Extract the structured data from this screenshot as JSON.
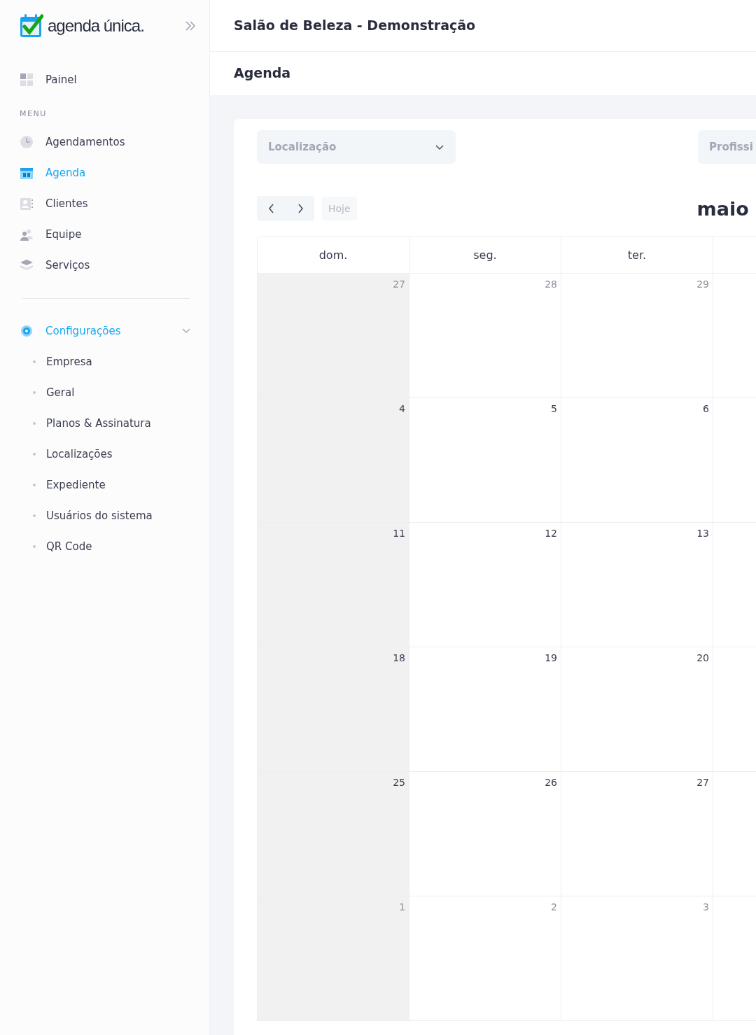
{
  "sidebar": {
    "brand": "agenda única.",
    "top_item": {
      "label": "Painel",
      "kind": "grid",
      "selected": false
    },
    "section_label": "MENU",
    "items": [
      {
        "label": "Agendamentos",
        "kind": "clock",
        "selected": false
      },
      {
        "label": "Agenda",
        "kind": "calendar",
        "selected": true
      },
      {
        "label": "Clientes",
        "kind": "contacts",
        "selected": false
      },
      {
        "label": "Equipe",
        "kind": "people",
        "selected": false
      },
      {
        "label": "Serviços",
        "kind": "layers",
        "selected": false
      }
    ],
    "settings": {
      "label": "Configurações",
      "selected": true,
      "expanded": true,
      "children": [
        {
          "label": "Empresa",
          "selected": false
        },
        {
          "label": "Geral",
          "selected": false
        },
        {
          "label": "Planos & Assinatura",
          "selected": false
        },
        {
          "label": "Localizações",
          "selected": false
        },
        {
          "label": "Expediente",
          "selected": false
        },
        {
          "label": "Usuários do sistema",
          "selected": false
        },
        {
          "label": "QR Code",
          "selected": false
        }
      ]
    }
  },
  "header": {
    "title": "Salão de Beleza - Demonstração",
    "subtitle": "Agenda"
  },
  "filters": [
    {
      "placeholder": "Localização",
      "kind": "dropdown"
    },
    {
      "placeholder": "Profissi",
      "kind": "partial"
    }
  ],
  "toolbar": {
    "today": "Hoje",
    "month_title": "maio"
  },
  "calendar": {
    "weekdays": [
      {
        "label": "dom.",
        "shaded": true
      },
      {
        "label": "seg.",
        "shaded": false
      },
      {
        "label": "ter.",
        "shaded": false
      }
    ],
    "weeks": [
      [
        {
          "day": "27",
          "muted": true
        },
        {
          "day": "28",
          "muted": true
        },
        {
          "day": "29",
          "muted": true
        }
      ],
      [
        {
          "day": "4",
          "muted": false
        },
        {
          "day": "5",
          "muted": false
        },
        {
          "day": "6",
          "muted": false
        }
      ],
      [
        {
          "day": "11",
          "muted": false
        },
        {
          "day": "12",
          "muted": false
        },
        {
          "day": "13",
          "muted": false
        }
      ],
      [
        {
          "day": "18",
          "muted": false
        },
        {
          "day": "19",
          "muted": false
        },
        {
          "day": "20",
          "muted": false
        }
      ],
      [
        {
          "day": "25",
          "muted": false
        },
        {
          "day": "26",
          "muted": false
        },
        {
          "day": "27",
          "muted": false
        }
      ],
      [
        {
          "day": "1",
          "muted": true
        },
        {
          "day": "2",
          "muted": true
        },
        {
          "day": "3",
          "muted": true
        }
      ]
    ]
  }
}
